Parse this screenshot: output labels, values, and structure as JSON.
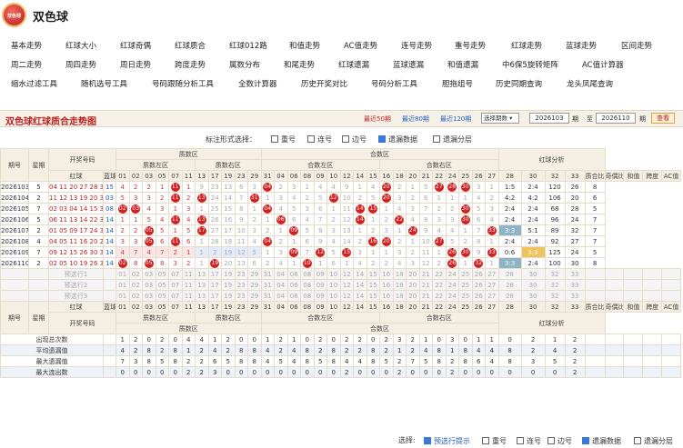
{
  "app": {
    "title": "双色球",
    "logo_text": "双色球"
  },
  "nav": [
    [
      "基本走势",
      "红球大小",
      "红球奇偶",
      "红球质合",
      "红球012路",
      "和值走势",
      "AC值走势",
      "连号走势",
      "重号走势",
      "红球走势",
      "蓝球走势",
      "区间走势"
    ],
    [
      "周二走势",
      "周四走势",
      "周日走势",
      "跨度走势",
      "属数分布",
      "和尾走势",
      "红球遗漏",
      "蓝球遗漏",
      "和值遗漏",
      "中6保5旋转矩阵",
      "AC值计算器"
    ],
    [
      "缩水过滤工具",
      "随机选号工具",
      "号码跟随分析工具",
      "全数计算器",
      "历史开奖对比",
      "号码分析工具",
      "胆拖组号",
      "历史同期查询",
      "龙头凤尾查询"
    ]
  ],
  "bar": {
    "title": "双色球红球质合走势图",
    "recent50": "最近50期",
    "recent80": "最近80期",
    "recent120": "最近120期",
    "select": "选择期数",
    "from": "2026103",
    "from_unit": "期",
    "to_sep": "至",
    "to": "2026110",
    "to_unit": "期",
    "query": "查看"
  },
  "opts": {
    "label": "标注形式选择：",
    "items": [
      {
        "label": "重号",
        "checked": false
      },
      {
        "label": "连号",
        "checked": false
      },
      {
        "label": "边号",
        "checked": false
      },
      {
        "label": "遗漏数据",
        "checked": true
      },
      {
        "label": "遗漏分层",
        "checked": false
      }
    ]
  },
  "table": {
    "hdr_period": "期号",
    "hdr_week": "星期",
    "hdr_draw": "开奖号码",
    "hdr_red": "红球",
    "hdr_blue": "蓝球",
    "hdr_prime": "质数区",
    "hdr_prime_l": "质数左区",
    "hdr_prime_r": "质数右区",
    "hdr_comp": "合数区",
    "hdr_comp_l": "合数左区",
    "hdr_comp_r": "合数右区",
    "hdr_analysis": "红球分析",
    "hdr_pc": "质合比",
    "hdr_oe": "奇偶比",
    "hdr_sum": "和值",
    "hdr_span": "跨度",
    "hdr_ac": "AC值",
    "rows": [
      {
        "p": "2026103",
        "w": "5",
        "red": "04 11 20 27 28 30",
        "blue": "15",
        "pc": "1:5",
        "oe": "2:4",
        "sum": "120",
        "span": "26",
        "ac": "8",
        "pm": [
          4,
          2,
          2,
          1,
          "11",
          1,
          9,
          23,
          13,
          6,
          3
        ],
        "cm": [
          "04",
          2,
          3,
          1,
          4,
          4,
          9,
          1,
          4,
          "20",
          2,
          1,
          5,
          "27",
          "28",
          "30",
          3,
          1
        ]
      },
      {
        "p": "2026104",
        "w": "2",
        "red": "11 12 13 19 20 31",
        "blue": "03",
        "pc": "4:2",
        "oe": "4:2",
        "sum": "106",
        "span": "20",
        "ac": "6",
        "pm": [
          5,
          3,
          3,
          2,
          "11",
          2,
          "13",
          24,
          14,
          7,
          "31"
        ],
        "cm": [
          1,
          3,
          4,
          2,
          5,
          "12",
          10,
          2,
          5,
          "20",
          3,
          2,
          6,
          1,
          1,
          1,
          4,
          2
        ]
      },
      {
        "p": "2026105",
        "w": "7",
        "red": "02 03 04 14 15 30",
        "blue": "08",
        "pc": "2:4",
        "oe": "2:4",
        "sum": "68",
        "span": "28",
        "ac": "5",
        "pm": [
          "02",
          "03",
          4,
          3,
          1,
          3,
          1,
          25,
          15,
          8,
          1
        ],
        "cm": [
          "04",
          4,
          5,
          3,
          6,
          1,
          11,
          "14",
          "15",
          1,
          4,
          3,
          7,
          2,
          2,
          "30",
          5,
          3
        ]
      },
      {
        "p": "2026106",
        "w": "5",
        "red": "06 11 13 14 22 30",
        "blue": "14",
        "pc": "2:4",
        "oe": "2:4",
        "sum": "96",
        "span": "24",
        "ac": "7",
        "pm": [
          1,
          1,
          5,
          4,
          "11",
          4,
          "13",
          26,
          16,
          9,
          2
        ],
        "cm": [
          1,
          "06",
          6,
          4,
          7,
          2,
          12,
          "14",
          1,
          2,
          "22",
          4,
          8,
          3,
          3,
          "30",
          6,
          4
        ]
      },
      {
        "p": "2026107",
        "w": "2",
        "red": "01 05 09 17 24 33",
        "blue": "14",
        "pc": "3:3",
        "oe": "5:1",
        "sum": "89",
        "span": "32",
        "ac": "7",
        "pm": [
          2,
          2,
          "05",
          5,
          1,
          5,
          "17",
          27,
          17,
          10,
          3
        ],
        "cm": [
          2,
          1,
          "09",
          5,
          8,
          3,
          13,
          1,
          2,
          3,
          1,
          "24",
          9,
          4,
          4,
          1,
          7,
          "33"
        ],
        "hpc": "tl"
      },
      {
        "p": "2026108",
        "w": "4",
        "red": "04 05 11 16 20 27",
        "blue": "14",
        "pc": "2:4",
        "oe": "2:4",
        "sum": "92",
        "span": "27",
        "ac": "7",
        "pm": [
          3,
          3,
          "05",
          6,
          "11",
          6,
          1,
          28,
          18,
          11,
          4
        ],
        "cm": [
          "04",
          2,
          1,
          6,
          9,
          4,
          14,
          2,
          "16",
          "20",
          2,
          1,
          10,
          "27",
          5,
          2,
          8,
          1
        ]
      },
      {
        "p": "2026109",
        "w": "7",
        "red": "09 12 15 26 30 33",
        "blue": "14",
        "pc": "0:6",
        "oe": "3:3",
        "sum": "125",
        "span": "24",
        "ac": "5",
        "pm": [
          4,
          7,
          4,
          7,
          2,
          1,
          1,
          2,
          19,
          12,
          5
        ],
        "cm": [
          1,
          3,
          "09",
          7,
          "12",
          5,
          "15",
          3,
          1,
          1,
          3,
          2,
          11,
          1,
          "26",
          "30",
          9,
          "33"
        ],
        "hoe": "to",
        "shade": true
      },
      {
        "p": "2026110",
        "w": "2",
        "red": "02 05 10 19 26 32",
        "blue": "14",
        "pc": "3:3",
        "oe": "2:4",
        "sum": "100",
        "span": "30",
        "ac": "8",
        "pm": [
          "02",
          8,
          "05",
          8,
          3,
          2,
          1,
          "19",
          20,
          13,
          6
        ],
        "cm": [
          2,
          4,
          1,
          "10",
          1,
          6,
          1,
          4,
          2,
          2,
          4,
          3,
          12,
          2,
          "26",
          1,
          "32",
          1
        ],
        "hpc": "tl"
      }
    ],
    "pred_labels": [
      "预选行1",
      "预选行2",
      "预选行3"
    ],
    "pred_nums": [
      "01",
      "02",
      "03",
      "05",
      "07",
      "11",
      "13",
      "17",
      "19",
      "23",
      "29",
      "31",
      "04",
      "06",
      "08",
      "09",
      "10",
      "12",
      "14",
      "15",
      "16",
      "18",
      "20",
      "21",
      "22",
      "24",
      "25",
      "26",
      "27",
      "28",
      "30",
      "32",
      "33"
    ],
    "stats": [
      {
        "label": "出现总次数",
        "vals": [
          1,
          2,
          0,
          2,
          0,
          4,
          4,
          1,
          2,
          0,
          0,
          1,
          2,
          1,
          0,
          2,
          0,
          2,
          2,
          0,
          2,
          3,
          2,
          1,
          0,
          3,
          0,
          1,
          1,
          0,
          2,
          1,
          2,
          4,
          2,
          1,
          2
        ]
      },
      {
        "label": "平均遗漏值",
        "vals": [
          4,
          2,
          8,
          2,
          8,
          1,
          2,
          4,
          2,
          8,
          8,
          4,
          2,
          4,
          8,
          2,
          8,
          2,
          2,
          8,
          2,
          1,
          2,
          4,
          8,
          1,
          8,
          4,
          4,
          8,
          2,
          4,
          2,
          1,
          2,
          4,
          2
        ]
      },
      {
        "label": "最大遗漏值",
        "vals": [
          7,
          3,
          8,
          5,
          8,
          2,
          2,
          6,
          5,
          8,
          8,
          4,
          5,
          4,
          8,
          5,
          8,
          4,
          4,
          8,
          5,
          2,
          7,
          5,
          8,
          2,
          8,
          6,
          4,
          8,
          3,
          5,
          2,
          2,
          3,
          4,
          3
        ]
      },
      {
        "label": "最大连出数",
        "vals": [
          0,
          0,
          0,
          0,
          0,
          2,
          2,
          3,
          0,
          0,
          0,
          0,
          0,
          0,
          0,
          0,
          0,
          2,
          0,
          0,
          0,
          2,
          0,
          0,
          0,
          2,
          0,
          0,
          0,
          0,
          0,
          0,
          2,
          0,
          0,
          0,
          0
        ]
      }
    ]
  },
  "footer": {
    "label": "选择:",
    "items": [
      {
        "label": "预选行提示",
        "checked": true,
        "color": "#1f5fb8"
      },
      {
        "label": "重号",
        "checked": false
      },
      {
        "label": "连号",
        "checked": false
      },
      {
        "label": "边号",
        "checked": false
      },
      {
        "label": "遗漏数据",
        "checked": true
      },
      {
        "label": "遗漏分层",
        "checked": false
      }
    ]
  }
}
